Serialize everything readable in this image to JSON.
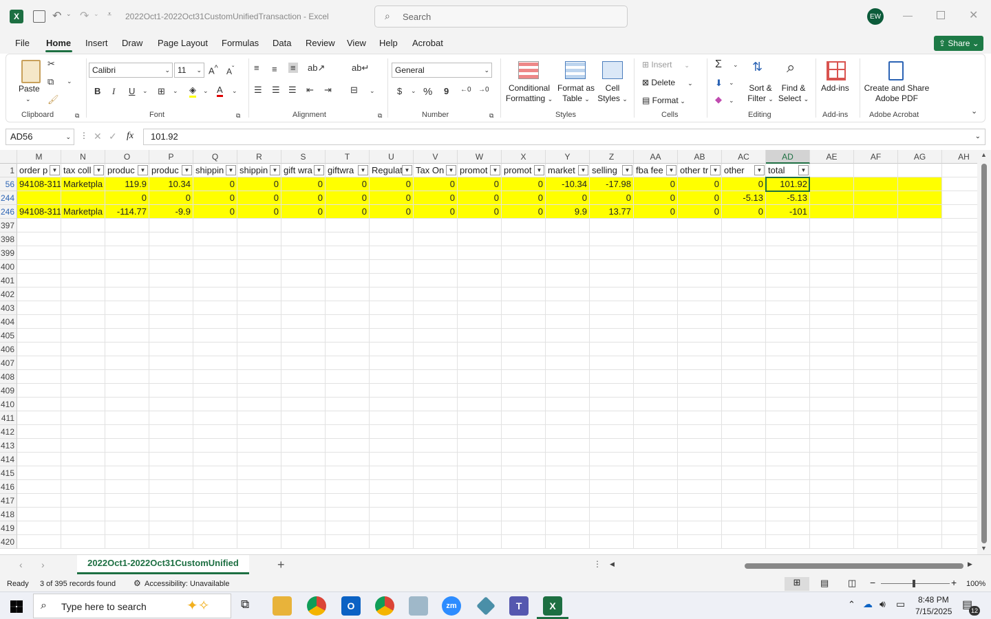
{
  "window": {
    "title": "2022Oct1-2022Oct31CustomUnifiedTransaction  -  Excel",
    "search_placeholder": "Search",
    "avatar_initials": "EW"
  },
  "menu": {
    "tabs": [
      "File",
      "Home",
      "Insert",
      "Draw",
      "Page Layout",
      "Formulas",
      "Data",
      "Review",
      "View",
      "Help",
      "Acrobat"
    ],
    "active": "Home",
    "share_label": "Share"
  },
  "ribbon": {
    "clipboard": {
      "paste": "Paste",
      "label": "Clipboard"
    },
    "font": {
      "name": "Calibri",
      "size": "11",
      "label": "Font",
      "bold": "B",
      "italic": "I",
      "underline": "U"
    },
    "alignment": {
      "label": "Alignment"
    },
    "number": {
      "format": "General",
      "label": "Number",
      "currency": "$",
      "percent": "%",
      "comma": "9"
    },
    "styles": {
      "cond_fmt_1": "Conditional",
      "cond_fmt_2": "Formatting",
      "fmt_table_1": "Format as",
      "fmt_table_2": "Table",
      "cell_styles_1": "Cell",
      "cell_styles_2": "Styles",
      "label": "Styles"
    },
    "cells": {
      "insert": "Insert",
      "delete": "Delete",
      "format": "Format",
      "label": "Cells"
    },
    "editing": {
      "sort_1": "Sort &",
      "sort_2": "Filter",
      "find_1": "Find &",
      "find_2": "Select",
      "label": "Editing"
    },
    "addins": {
      "btn": "Add-ins",
      "label": "Add-ins"
    },
    "acrobat": {
      "btn_1": "Create and Share",
      "btn_2": "Adobe PDF",
      "label": "Adobe Acrobat"
    }
  },
  "formula_bar": {
    "name_box": "AD56",
    "fx": "fx",
    "value": "101.92"
  },
  "columns": [
    "M",
    "N",
    "O",
    "P",
    "Q",
    "R",
    "S",
    "T",
    "U",
    "V",
    "W",
    "X",
    "Y",
    "Z",
    "AA",
    "AB",
    "AC",
    "AD",
    "AE",
    "AF",
    "AG",
    "AH"
  ],
  "header_row": {
    "row_num": "1",
    "cells": [
      "order p",
      "tax coll",
      "produc",
      "produc",
      "shippin",
      "shippin",
      "gift wra",
      "giftwra",
      "Regulat",
      "Tax On",
      "promot",
      "promot",
      "market",
      "selling",
      "fba fee",
      "other tr",
      "other",
      "total"
    ]
  },
  "data_rows": [
    {
      "row_num": "56",
      "cells": [
        "94108-311",
        "Marketpla",
        "119.9",
        "10.34",
        "0",
        "0",
        "0",
        "0",
        "0",
        "0",
        "0",
        "0",
        "-10.34",
        "-17.98",
        "0",
        "0",
        "0",
        "101.92"
      ]
    },
    {
      "row_num": "244",
      "cells": [
        "",
        "",
        "0",
        "0",
        "0",
        "0",
        "0",
        "0",
        "0",
        "0",
        "0",
        "0",
        "0",
        "0",
        "0",
        "0",
        "-5.13",
        "-5.13"
      ]
    },
    {
      "row_num": "246",
      "cells": [
        "94108-311",
        "Marketpla",
        "-114.77",
        "-9.9",
        "0",
        "0",
        "0",
        "0",
        "0",
        "0",
        "0",
        "0",
        "9.9",
        "13.77",
        "0",
        "0",
        "0",
        "-101"
      ]
    }
  ],
  "empty_rows": [
    "397",
    "398",
    "399",
    "400",
    "401",
    "402",
    "403",
    "404",
    "405",
    "406",
    "407",
    "408",
    "409",
    "410",
    "411",
    "412",
    "413",
    "414",
    "415",
    "416",
    "417",
    "418",
    "419",
    "420"
  ],
  "sheet_tab": "2022Oct1-2022Oct31CustomUnified",
  "status": {
    "ready": "Ready",
    "records": "3 of 395 records found",
    "accessibility": "Accessibility: Unavailable",
    "zoom": "100%"
  },
  "taskbar": {
    "search_placeholder": "Type here to search",
    "time": "8:48 PM",
    "date": "7/15/2025",
    "notif_count": "12"
  }
}
